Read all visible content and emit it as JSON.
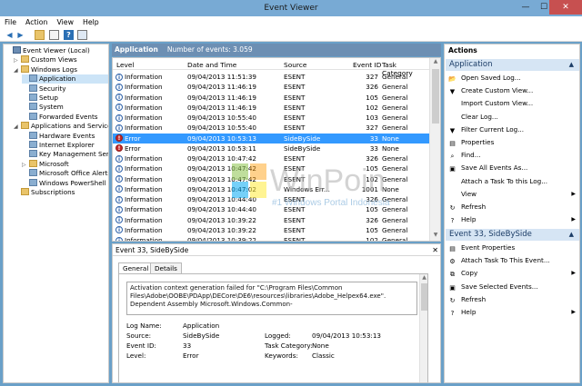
{
  "window": {
    "title": "Event Viewer",
    "minimize": "—",
    "maximize": "☐",
    "close": "✕"
  },
  "menu": [
    "File",
    "Action",
    "View",
    "Help"
  ],
  "tree": [
    {
      "label": "Event Viewer (Local)",
      "indent": 0,
      "exp": "",
      "icon": "pc"
    },
    {
      "label": "Custom Views",
      "indent": 1,
      "exp": "▷",
      "icon": "folder"
    },
    {
      "label": "Windows Logs",
      "indent": 1,
      "exp": "◢",
      "icon": "folder"
    },
    {
      "label": "Application",
      "indent": 2,
      "exp": "",
      "icon": "logic",
      "selected": true
    },
    {
      "label": "Security",
      "indent": 2,
      "exp": "",
      "icon": "logic"
    },
    {
      "label": "Setup",
      "indent": 2,
      "exp": "",
      "icon": "logic"
    },
    {
      "label": "System",
      "indent": 2,
      "exp": "",
      "icon": "logic"
    },
    {
      "label": "Forwarded Events",
      "indent": 2,
      "exp": "",
      "icon": "logic"
    },
    {
      "label": "Applications and Services Lo",
      "indent": 1,
      "exp": "◢",
      "icon": "folder"
    },
    {
      "label": "Hardware Events",
      "indent": 2,
      "exp": "",
      "icon": "logic"
    },
    {
      "label": "Internet Explorer",
      "indent": 2,
      "exp": "",
      "icon": "logic"
    },
    {
      "label": "Key Management Service",
      "indent": 2,
      "exp": "",
      "icon": "logic"
    },
    {
      "label": "Microsoft",
      "indent": 2,
      "exp": "▷",
      "icon": "folder"
    },
    {
      "label": "Microsoft Office Alerts",
      "indent": 2,
      "exp": "",
      "icon": "logic"
    },
    {
      "label": "Windows PowerShell",
      "indent": 2,
      "exp": "",
      "icon": "logic"
    },
    {
      "label": "Subscriptions",
      "indent": 1,
      "exp": "",
      "icon": "folder"
    }
  ],
  "center": {
    "log_name": "Application",
    "event_count": "Number of events: 3.059"
  },
  "columns": [
    "Level",
    "Date and Time",
    "Source",
    "Event ID",
    "Task Category"
  ],
  "events": [
    {
      "level": "Information",
      "type": "info",
      "date": "09/04/2013 11:51:39",
      "source": "ESENT",
      "id": "327",
      "cat": "General"
    },
    {
      "level": "Information",
      "type": "info",
      "date": "09/04/2013 11:46:19",
      "source": "ESENT",
      "id": "326",
      "cat": "General"
    },
    {
      "level": "Information",
      "type": "info",
      "date": "09/04/2013 11:46:19",
      "source": "ESENT",
      "id": "105",
      "cat": "General"
    },
    {
      "level": "Information",
      "type": "info",
      "date": "09/04/2013 11:46:19",
      "source": "ESENT",
      "id": "102",
      "cat": "General"
    },
    {
      "level": "Information",
      "type": "info",
      "date": "09/04/2013 10:55:40",
      "source": "ESENT",
      "id": "103",
      "cat": "General"
    },
    {
      "level": "Information",
      "type": "info",
      "date": "09/04/2013 10:55:40",
      "source": "ESENT",
      "id": "327",
      "cat": "General"
    },
    {
      "level": "Error",
      "type": "err",
      "date": "09/04/2013 10:53:13",
      "source": "SideBySide",
      "id": "33",
      "cat": "None",
      "selected": true
    },
    {
      "level": "Error",
      "type": "err",
      "date": "09/04/2013 10:53:11",
      "source": "SideBySide",
      "id": "33",
      "cat": "None"
    },
    {
      "level": "Information",
      "type": "info",
      "date": "09/04/2013 10:47:42",
      "source": "ESENT",
      "id": "326",
      "cat": "General"
    },
    {
      "level": "Information",
      "type": "info",
      "date": "09/04/2013 10:47:42",
      "source": "ESENT",
      "id": "105",
      "cat": "General"
    },
    {
      "level": "Information",
      "type": "info",
      "date": "09/04/2013 10:47:42",
      "source": "ESENT",
      "id": "102",
      "cat": "General"
    },
    {
      "level": "Information",
      "type": "info",
      "date": "09/04/2013 10:47:02",
      "source": "Windows Err...",
      "id": "1001",
      "cat": "None"
    },
    {
      "level": "Information",
      "type": "info",
      "date": "09/04/2013 10:44:40",
      "source": "ESENT",
      "id": "326",
      "cat": "General"
    },
    {
      "level": "Information",
      "type": "info",
      "date": "09/04/2013 10:44:40",
      "source": "ESENT",
      "id": "105",
      "cat": "General"
    },
    {
      "level": "Information",
      "type": "info",
      "date": "09/04/2013 10:39:22",
      "source": "ESENT",
      "id": "326",
      "cat": "General"
    },
    {
      "level": "Information",
      "type": "info",
      "date": "09/04/2013 10:39:22",
      "source": "ESENT",
      "id": "105",
      "cat": "General"
    },
    {
      "level": "Information",
      "type": "info",
      "date": "09/04/2013 10:39:22",
      "source": "ESENT",
      "id": "102",
      "cat": "General"
    }
  ],
  "detail": {
    "header": "Event 33, SideBySide",
    "close": "✕",
    "tabs": [
      "General",
      "Details"
    ],
    "message": "Activation context generation failed for \"C:\\Program Files\\Common Files\\Adobe\\OOBE\\PDApp\\DECore\\DE6\\resources\\libraries\\Adobe_Helpex64.exe\". Dependent Assembly Microsoft.Windows.Common-",
    "props_left": [
      {
        "k": "Log Name:",
        "v": "Application"
      },
      {
        "k": "Source:",
        "v": "SideBySide"
      },
      {
        "k": "Event ID:",
        "v": "33"
      },
      {
        "k": "Level:",
        "v": "Error"
      }
    ],
    "props_right": [
      {
        "k": "Logged:",
        "v": "09/04/2013 10:53:13"
      },
      {
        "k": "Task Category:",
        "v": "None"
      },
      {
        "k": "Keywords:",
        "v": "Classic"
      }
    ]
  },
  "actions": {
    "title": "Actions",
    "section1": "Application",
    "items1": [
      {
        "label": "Open Saved Log...",
        "icon": "📂",
        "sub": false
      },
      {
        "label": "Create Custom View...",
        "icon": "▼",
        "sub": false
      },
      {
        "label": "Import Custom View...",
        "icon": "",
        "sub": false
      },
      {
        "label": "Clear Log...",
        "icon": "",
        "sub": false
      },
      {
        "label": "Filter Current Log...",
        "icon": "▼",
        "sub": false
      },
      {
        "label": "Properties",
        "icon": "▤",
        "sub": false
      },
      {
        "label": "Find...",
        "icon": "⌕",
        "sub": false
      },
      {
        "label": "Save All Events As...",
        "icon": "▣",
        "sub": false
      },
      {
        "label": "Attach a Task To this Log...",
        "icon": "",
        "sub": false
      },
      {
        "label": "View",
        "icon": "",
        "sub": true
      },
      {
        "label": "Refresh",
        "icon": "↻",
        "sub": false
      },
      {
        "label": "Help",
        "icon": "?",
        "sub": true
      }
    ],
    "section2": "Event 33, SideBySide",
    "items2": [
      {
        "label": "Event Properties",
        "icon": "▤",
        "sub": false
      },
      {
        "label": "Attach Task To This Event...",
        "icon": "⚙",
        "sub": false
      },
      {
        "label": "Copy",
        "icon": "⧉",
        "sub": true
      },
      {
        "label": "Save Selected Events...",
        "icon": "▣",
        "sub": false
      },
      {
        "label": "Refresh",
        "icon": "↻",
        "sub": false
      },
      {
        "label": "Help",
        "icon": "?",
        "sub": true
      }
    ]
  },
  "watermark": {
    "brand": "WinPoin",
    "tagline": "#1 Windows Portal Indonesia"
  }
}
